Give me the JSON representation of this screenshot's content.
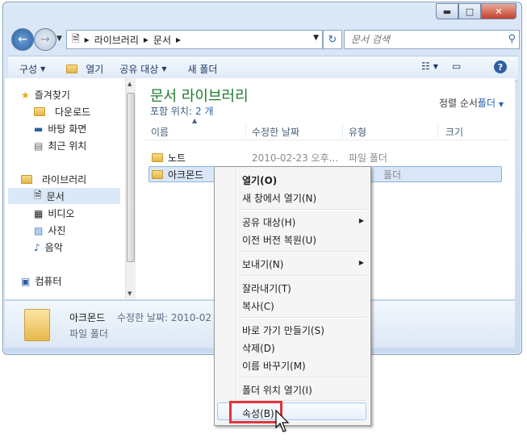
{
  "window": {
    "caption": {
      "min": "▬",
      "max": "□",
      "close": "✕"
    }
  },
  "nav": {
    "back_icon": "←",
    "fwd_icon": "→",
    "address": {
      "root_sep": "▸",
      "seg1": "라이브러리",
      "seg2": "문서"
    },
    "refresh_icon": "↻",
    "search_placeholder": "문서 검색"
  },
  "toolbar": {
    "organize": "구성",
    "open": "열기",
    "share": "공유 대상",
    "new_folder": "새 폴더"
  },
  "sidebar": {
    "favorites": "즐겨찾기",
    "downloads": "다운로드",
    "desktop": "바탕 화면",
    "recent": "최근 위치",
    "libraries": "라이브러리",
    "documents": "문서",
    "videos": "비디오",
    "pictures": "사진",
    "music": "음악",
    "computer": "컴퓨터"
  },
  "main": {
    "title": "문서 라이브러리",
    "includes_label": "포함 위치:",
    "includes_count": "2 개",
    "sort_label": "정렬 순서:",
    "sort_value": "폴더",
    "columns": {
      "name": "이름",
      "modified": "수정한 날짜",
      "type": "유형",
      "size": "크기"
    },
    "rows": [
      {
        "name": "노트",
        "modified": "2010-02-23 오후...",
        "type": "파일 폴더"
      },
      {
        "name": "아크몬드",
        "modified": "",
        "type": "폴더"
      }
    ]
  },
  "details": {
    "name": "아크몬드",
    "meta": "수정한 날짜: 2010-02",
    "type": "파일 폴더"
  },
  "context_menu": {
    "open": "열기(O)",
    "open_new": "새 창에서 열기(N)",
    "share": "공유 대상(H)",
    "restore": "이전 버전 복원(U)",
    "send_to": "보내기(N)",
    "cut": "잘라내기(T)",
    "copy": "복사(C)",
    "shortcut": "바로 가기 만들기(S)",
    "delete": "삭제(D)",
    "rename": "이름 바꾸기(M)",
    "open_location": "폴더 위치 열기(I)",
    "properties": "속성(B)"
  },
  "colors": {
    "accent": "#2865b5",
    "highlight": "#e2343b",
    "title_green": "#1e7b2d"
  }
}
